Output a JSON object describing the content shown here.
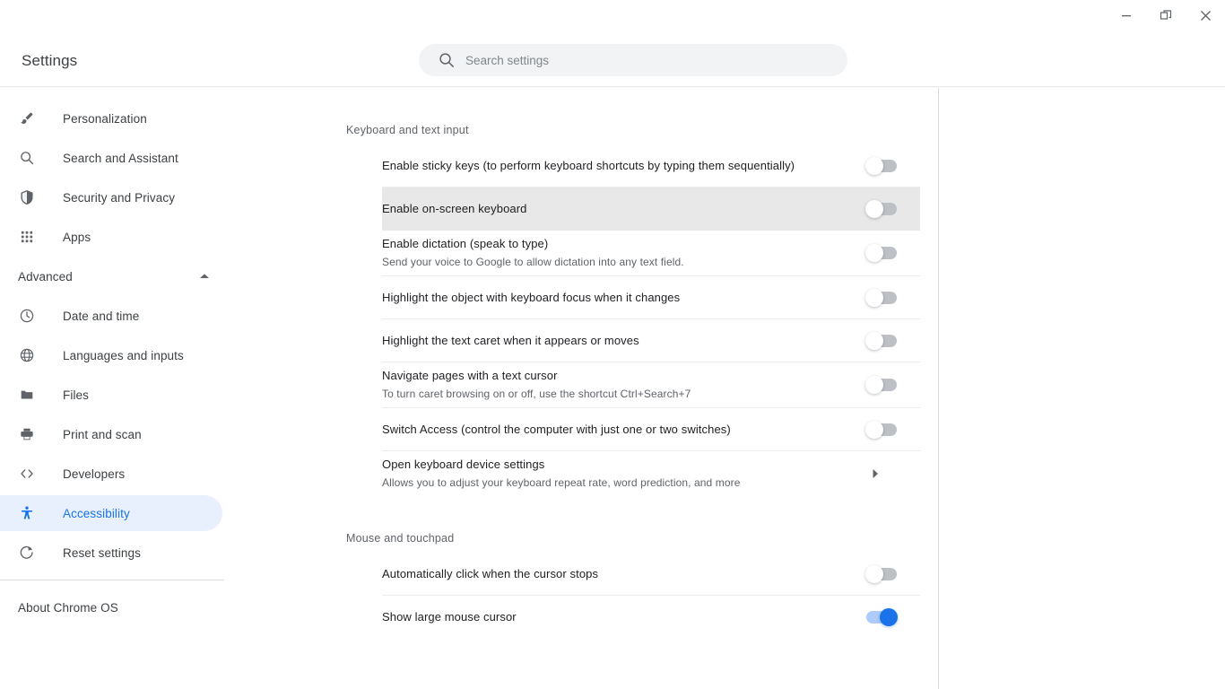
{
  "window": {
    "controls": [
      {
        "name": "minimize",
        "label": "Minimize"
      },
      {
        "name": "restore",
        "label": "Restore"
      },
      {
        "name": "close",
        "label": "Close"
      }
    ]
  },
  "header": {
    "title": "Settings",
    "search": {
      "placeholder": "Search settings",
      "value": "",
      "icon": "search-icon"
    }
  },
  "sidebar": {
    "items": [
      {
        "label": "Personalization",
        "icon": "brush-icon",
        "selected": false
      },
      {
        "label": "Search and Assistant",
        "icon": "search-icon",
        "selected": false
      },
      {
        "label": "Security and Privacy",
        "icon": "shield-icon",
        "selected": false
      },
      {
        "label": "Apps",
        "icon": "apps-grid-icon",
        "selected": false
      }
    ],
    "advanced": {
      "label": "Advanced",
      "expanded": true,
      "arrow_icon": "chevron-up-icon"
    },
    "advanced_items": [
      {
        "label": "Date and time",
        "icon": "clock-icon",
        "selected": false
      },
      {
        "label": "Languages and inputs",
        "icon": "globe-icon",
        "selected": false
      },
      {
        "label": "Files",
        "icon": "folder-icon",
        "selected": false
      },
      {
        "label": "Print and scan",
        "icon": "printer-icon",
        "selected": false
      },
      {
        "label": "Developers",
        "icon": "code-brackets-icon",
        "selected": false
      },
      {
        "label": "Accessibility",
        "icon": "accessibility-icon",
        "selected": true
      },
      {
        "label": "Reset settings",
        "icon": "reset-icon",
        "selected": false
      }
    ],
    "about": {
      "label": "About Chrome OS"
    },
    "accent_color": "#1a73e8",
    "selected_background": "#e8f0fe"
  },
  "main": {
    "sections": [
      {
        "title": "Keyboard and text input",
        "rows": [
          {
            "title": "Enable sticky keys (to perform keyboard shortcuts by typing them sequentially)",
            "sub": "",
            "control": "toggle",
            "state": "off",
            "highlight": false
          },
          {
            "title": "Enable on-screen keyboard",
            "sub": "",
            "control": "toggle",
            "state": "off",
            "highlight": true
          },
          {
            "title": "Enable dictation (speak to type)",
            "sub": "Send your voice to Google to allow dictation into any text field.",
            "control": "toggle",
            "state": "off",
            "highlight": false
          },
          {
            "title": "Highlight the object with keyboard focus when it changes",
            "sub": "",
            "control": "toggle",
            "state": "off",
            "highlight": false
          },
          {
            "title": "Highlight the text caret when it appears or moves",
            "sub": "",
            "control": "toggle",
            "state": "off",
            "highlight": false
          },
          {
            "title": "Navigate pages with a text cursor",
            "sub": "To turn caret browsing on or off, use the shortcut Ctrl+Search+7",
            "control": "toggle",
            "state": "off",
            "highlight": false
          },
          {
            "title": "Switch Access (control the computer with just one or two switches)",
            "sub": "",
            "control": "toggle",
            "state": "off",
            "highlight": false
          },
          {
            "title": "Open keyboard device settings",
            "sub": "Allows you to adjust your keyboard repeat rate, word prediction, and more",
            "control": "chevron",
            "state": "",
            "highlight": false
          }
        ]
      },
      {
        "title": "Mouse and touchpad",
        "rows": [
          {
            "title": "Automatically click when the cursor stops",
            "sub": "",
            "control": "toggle",
            "state": "off",
            "highlight": false
          },
          {
            "title": "Show large mouse cursor",
            "sub": "",
            "control": "toggle",
            "state": "on",
            "highlight": false
          }
        ]
      }
    ]
  },
  "colors": {
    "accent": "#1a73e8",
    "toggle_off_track": "#bdc1c6",
    "toggle_on_track": "#aecbfa",
    "row_highlight": "#e8e8e8",
    "text_primary": "#202124",
    "text_secondary": "#5f6368"
  }
}
